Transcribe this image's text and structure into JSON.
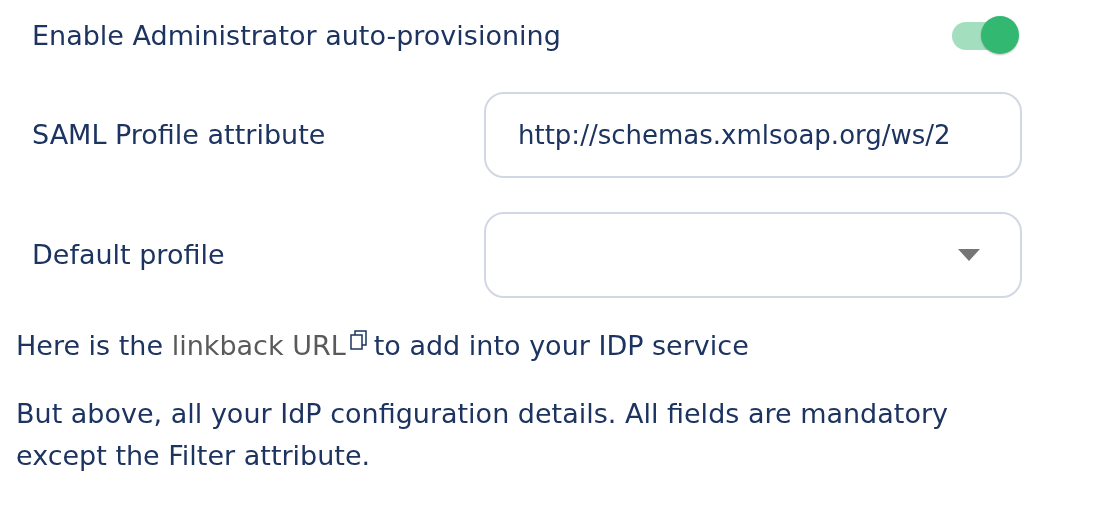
{
  "toggle": {
    "label": "Enable Administrator auto-provisioning",
    "on": true
  },
  "fields": [
    {
      "kind": "text",
      "label": "SAML Profile attribute",
      "value": "http://schemas.xmlsoap.org/ws/2"
    },
    {
      "kind": "select",
      "label": "Default profile"
    }
  ],
  "linkback": {
    "before": "Here is the",
    "link": "linkback URL",
    "after": "to add into your IDP service"
  },
  "note": "But above, all your IdP configuration details. All fields are mandatory except the Filter attribute."
}
